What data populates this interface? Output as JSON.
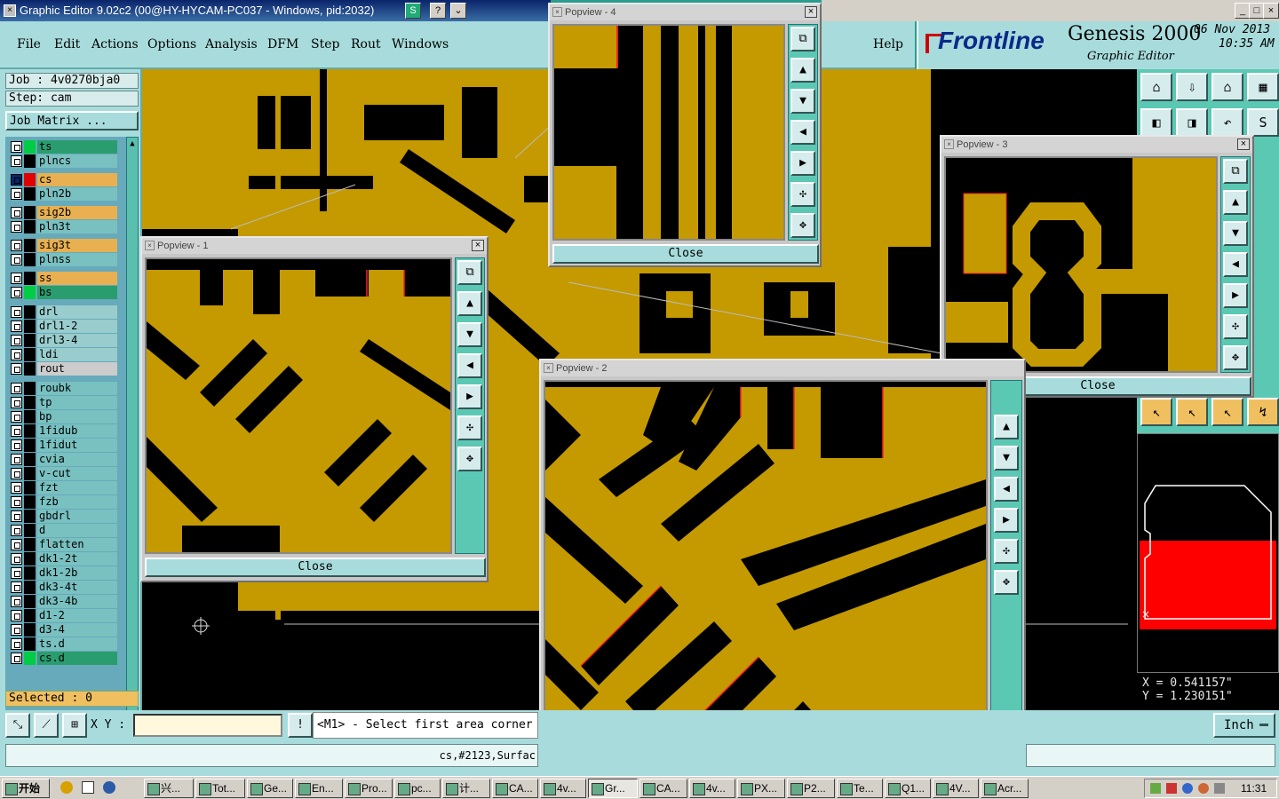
{
  "window": {
    "title": "Graphic Editor 9.02c2 (00@HY-HYCAM-PC037 - Windows, pid:2032)",
    "title_buttons": [
      "S",
      "?",
      "⌄"
    ],
    "right_buttons": [
      "_",
      "□",
      "×"
    ]
  },
  "menu": {
    "items": [
      "File",
      "Edit",
      "Actions",
      "Options",
      "Analysis",
      "DFM",
      "Step",
      "Rout",
      "Windows"
    ],
    "help": "Help"
  },
  "brand": {
    "logo": "Frontline",
    "product": "Genesis 2000",
    "subtitle": "Graphic Editor",
    "date": "06 Nov 2013",
    "time": "10:35 AM"
  },
  "job": {
    "job_label": "Job : 4v0270bja0",
    "step_label": "Step: cam",
    "matrix_button": "Job Matrix ..."
  },
  "layers": [
    {
      "name": "ts",
      "color": "#2a9d6f",
      "marker": ""
    },
    {
      "name": "plncs",
      "color": "#79c0c0",
      "marker": ""
    },
    {
      "name": "cs",
      "color": "#e8b050",
      "marker": "#e00000",
      "active": true
    },
    {
      "name": "pln2b",
      "color": "#79c0c0",
      "marker": ""
    },
    {
      "name": "sig2b",
      "color": "#e8b050",
      "marker": ""
    },
    {
      "name": "pln3t",
      "color": "#79c0c0",
      "marker": ""
    },
    {
      "name": "sig3t",
      "color": "#e8b050",
      "marker": ""
    },
    {
      "name": "plnss",
      "color": "#79c0c0",
      "marker": ""
    },
    {
      "name": "ss",
      "color": "#e8b050",
      "marker": ""
    },
    {
      "name": "bs",
      "color": "#2a9d6f",
      "marker": ""
    },
    {
      "name": "drl",
      "color": "#9cc",
      "marker": ""
    },
    {
      "name": "drl1-2",
      "color": "#9cc",
      "marker": ""
    },
    {
      "name": "drl3-4",
      "color": "#9cc",
      "marker": ""
    },
    {
      "name": "ldi",
      "color": "#9cc",
      "marker": ""
    },
    {
      "name": "rout",
      "color": "#ccc",
      "marker": ""
    },
    {
      "name": "roubk",
      "color": "#79c0c0",
      "marker": ""
    },
    {
      "name": "tp",
      "color": "#79c0c0",
      "marker": ""
    },
    {
      "name": "bp",
      "color": "#79c0c0",
      "marker": ""
    },
    {
      "name": "1fidub",
      "color": "#79c0c0",
      "marker": ""
    },
    {
      "name": "1fidut",
      "color": "#79c0c0",
      "marker": ""
    },
    {
      "name": "cvia",
      "color": "#79c0c0",
      "marker": ""
    },
    {
      "name": "v-cut",
      "color": "#79c0c0",
      "marker": ""
    },
    {
      "name": "fzt",
      "color": "#79c0c0",
      "marker": ""
    },
    {
      "name": "fzb",
      "color": "#79c0c0",
      "marker": ""
    },
    {
      "name": "gbdrl",
      "color": "#79c0c0",
      "marker": ""
    },
    {
      "name": "d",
      "color": "#79c0c0",
      "marker": ""
    },
    {
      "name": "flatten",
      "color": "#79c0c0",
      "marker": ""
    },
    {
      "name": "dk1-2t",
      "color": "#79c0c0",
      "marker": ""
    },
    {
      "name": "dk1-2b",
      "color": "#79c0c0",
      "marker": ""
    },
    {
      "name": "dk3-4t",
      "color": "#79c0c0",
      "marker": ""
    },
    {
      "name": "dk3-4b",
      "color": "#79c0c0",
      "marker": ""
    },
    {
      "name": "d1-2",
      "color": "#79c0c0",
      "marker": ""
    },
    {
      "name": "d3-4",
      "color": "#79c0c0",
      "marker": ""
    },
    {
      "name": "ts.d",
      "color": "#79c0c0",
      "marker": ""
    },
    {
      "name": "cs.d",
      "color": "#2a9d6f",
      "marker": ""
    }
  ],
  "selected": "Selected : 0",
  "popups": {
    "p1": {
      "title": "Popview - 1",
      "close": "Close"
    },
    "p2": {
      "title": "Popview - 2",
      "close": "Close"
    },
    "p3": {
      "title": "Popview - 3",
      "close": "Close"
    },
    "p4": {
      "title": "Popview - 4",
      "close": "Close"
    }
  },
  "coords": {
    "x": "X = 0.541157\"",
    "y": "Y = 1.230151\""
  },
  "cmd": {
    "xy_label": "X Y :",
    "xy_value": "",
    "prompt": "<M1> - Select first area corner",
    "units": "Inch"
  },
  "status": "cs,#2123,Surfac",
  "taskbar": {
    "start": "开始",
    "tasks": [
      "兴...",
      "Tot...",
      "Ge...",
      "En...",
      "Pro...",
      "pc...",
      "计...",
      "CA...",
      "4v...",
      "Gr...",
      "CA...",
      "4v...",
      "PX...",
      "P2...",
      "Te...",
      "Q1...",
      "4V...",
      "Acr..."
    ],
    "clock": "11:31"
  },
  "colors": {
    "copper": "#c49a00",
    "edge": "#ff2020",
    "teal": "#5bc8b4"
  }
}
